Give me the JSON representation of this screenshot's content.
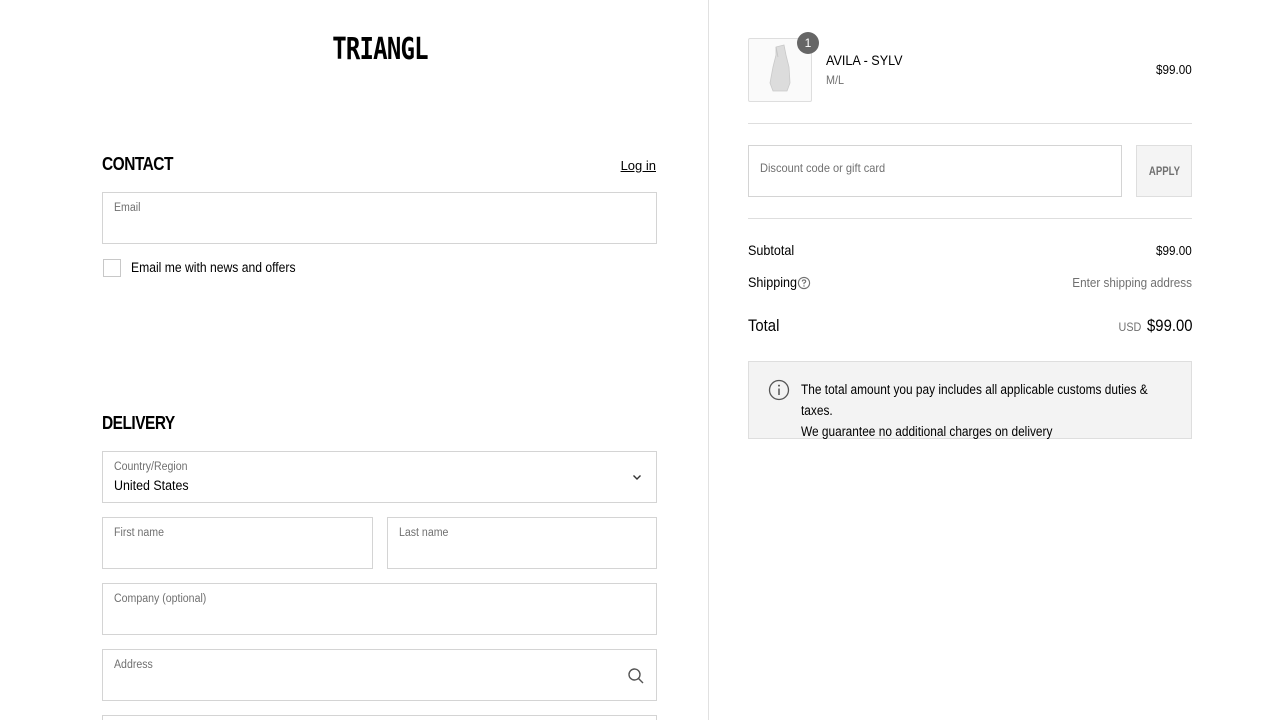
{
  "brand": {
    "logo_text": "TRIANGL"
  },
  "contact": {
    "title": "Contact",
    "login_label": "Log in",
    "email_label": "Email",
    "email_value": "",
    "newsletter_label": "Email me with news and offers",
    "newsletter_checked": false
  },
  "delivery": {
    "title": "Delivery",
    "country_label": "Country/Region",
    "country_value": "United States",
    "first_name_label": "First name",
    "last_name_label": "Last name",
    "company_label": "Company (optional)",
    "address_label": "Address"
  },
  "order": {
    "item": {
      "name": "AVILA - SYLV",
      "variant": "M/L",
      "price": "$99.00",
      "quantity": "1"
    },
    "discount": {
      "placeholder": "Discount code or gift card",
      "apply_label": "Apply"
    },
    "subtotal_label": "Subtotal",
    "subtotal_value": "$99.00",
    "shipping_label": "Shipping",
    "shipping_value": "Enter shipping address",
    "total_label": "Total",
    "total_currency": "USD",
    "total_value": "$99.00",
    "notice_line1": "The total amount you pay includes all applicable customs duties & taxes.",
    "notice_line2": "We guarantee no additional charges on delivery"
  },
  "icons": {
    "country_select": "chevron-down-icon",
    "address_search": "search-icon",
    "shipping_help": "question-icon",
    "notice": "info-icon"
  },
  "colors": {
    "border": "#d4d4d4",
    "muted_text": "#707070",
    "badge": "#666666",
    "notice_bg": "#f3f3f3"
  }
}
